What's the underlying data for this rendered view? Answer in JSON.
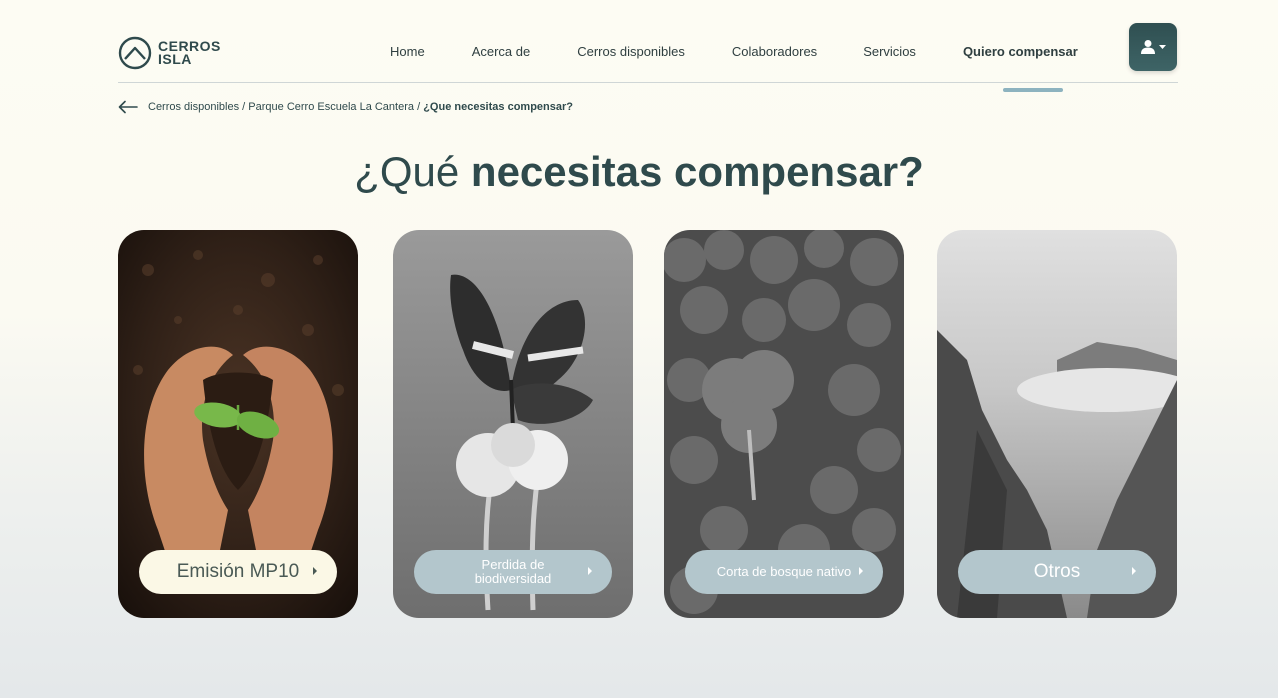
{
  "brand": {
    "line1": "CERROS",
    "line2": "ISLA"
  },
  "nav": {
    "items": [
      "Home",
      "Acerca de",
      "Cerros disponibles",
      "Colaboradores",
      "Servicios"
    ],
    "active": "Quiero compensar"
  },
  "breadcrumb": {
    "part1": "Cerros disponibles",
    "sep": "/",
    "part2": "Parque Cerro Escuela La Cantera",
    "current": "¿Que necesitas compensar?"
  },
  "heading": {
    "light": "¿Qué",
    "bold": "necesitas compensar?"
  },
  "cards": [
    {
      "label": "Emisión MP10",
      "icon": "seedling-hands-photo"
    },
    {
      "label": "Perdida de biodiversidad",
      "icon": "butterfly-photo"
    },
    {
      "label": "Corta de bosque nativo",
      "icon": "forest-photo"
    },
    {
      "label": "Otros",
      "icon": "mountain-valley-photo"
    }
  ],
  "colors": {
    "primary": "#2f4a4c",
    "accent": "#8db3bf",
    "button_gray": "#b3c6cc",
    "button_cream": "#fbf8e6"
  }
}
